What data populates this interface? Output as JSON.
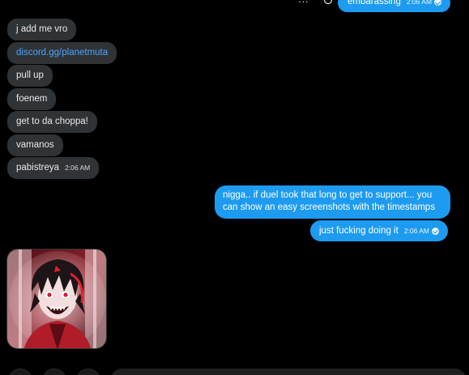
{
  "top": {
    "more_icon": "ellipsis-icon",
    "react_icon": "add-reaction-icon",
    "message": "embarassing",
    "time": "2:06 AM"
  },
  "incoming": [
    {
      "text": "j add me vro"
    },
    {
      "text": "discord.gg/planetmuta"
    },
    {
      "text": "pull up"
    },
    {
      "text": "foenem"
    },
    {
      "text": "get to da choppa!"
    },
    {
      "text": "vamanos"
    },
    {
      "text": "pabistreya",
      "time": "2:06 AM"
    }
  ],
  "outgoing": [
    {
      "line1": "nigga.. if duel took that long to get to support... you",
      "line2": "can show an easy screenshots with the timestamps"
    },
    {
      "text": "just fucking doing it",
      "time": "2:06 AM"
    }
  ],
  "colors": {
    "background": "#000000",
    "incoming_bubble": "#2f3336",
    "outgoing_bubble": "#1d9bf0",
    "link": "#4da3ff"
  }
}
